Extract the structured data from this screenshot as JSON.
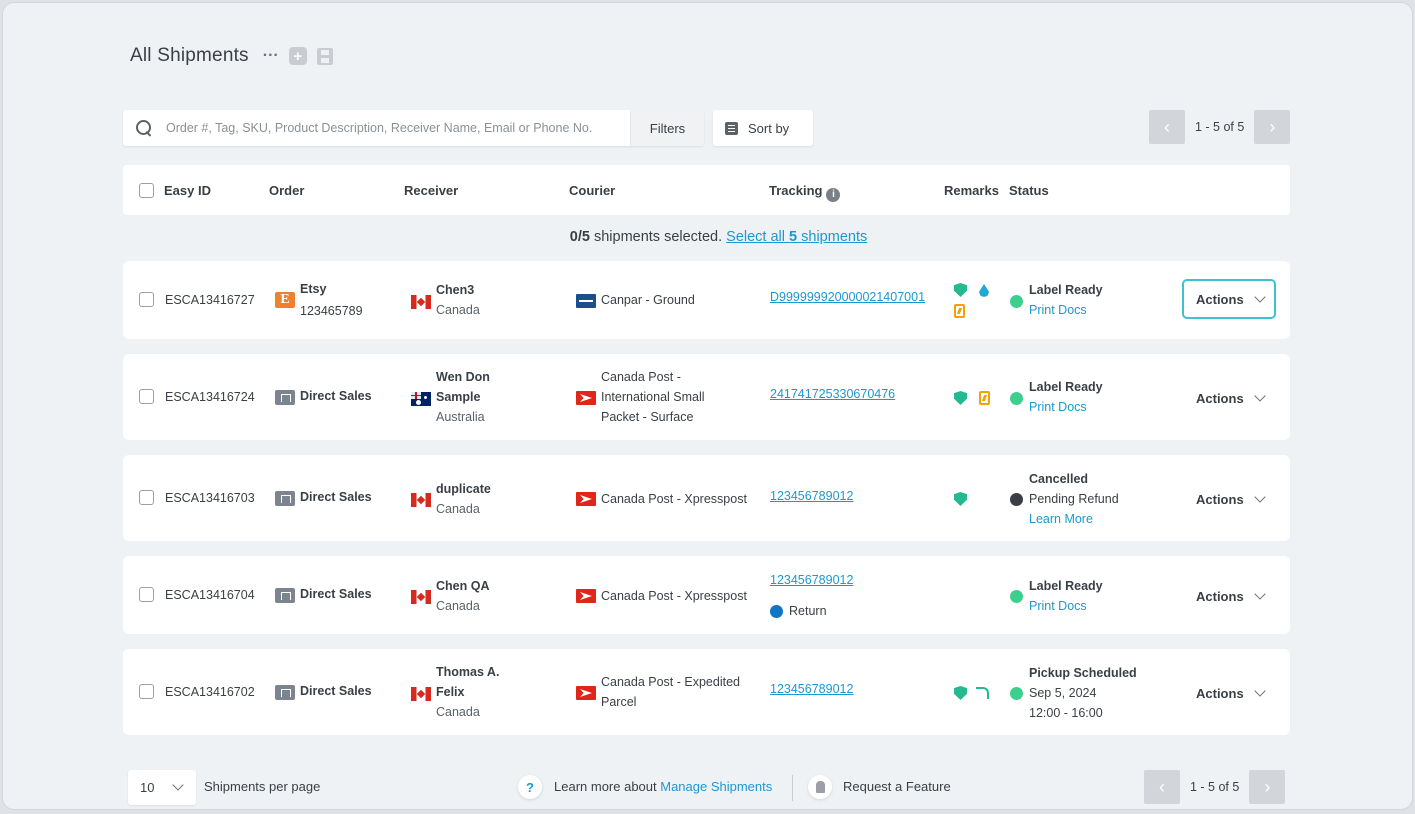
{
  "page": {
    "title": "All Shipments",
    "more_label": "···",
    "add_label": "+"
  },
  "search": {
    "placeholder": "Order #, Tag, SKU, Product Description, Receiver Name, Email or Phone No.",
    "filters_label": "Filters",
    "sort_label": "Sort by"
  },
  "pagination": {
    "range_text": "1 - 5 of 5",
    "prev": "‹",
    "next": "›"
  },
  "table": {
    "headers": {
      "easy_id": "Easy ID",
      "order": "Order",
      "receiver": "Receiver",
      "courier": "Courier",
      "tracking": "Tracking",
      "remarks": "Remarks",
      "status": "Status"
    },
    "selection": {
      "count": "0/5",
      "text": " shipments selected. ",
      "select_all_prefix": "Select all ",
      "select_all_count": "5",
      "select_all_suffix": " shipments"
    },
    "rows": [
      {
        "easy_id": "ESCA13416727",
        "order_source": "Etsy",
        "order_number": "123465789",
        "receiver_name_1": "Chen3",
        "receiver_name_2": "",
        "receiver_country": "Canada",
        "courier_1": "Canpar - Ground",
        "courier_2": "",
        "courier_3": "",
        "tracking": "D999999920000021407001",
        "tracking_extra": "",
        "status_1": "Label Ready",
        "status_2": "Print Docs",
        "status_3": "",
        "actions_label": "Actions"
      },
      {
        "easy_id": "ESCA13416724",
        "order_source": "Direct Sales",
        "order_number": "",
        "receiver_name_1": "Wen Don",
        "receiver_name_2": "Sample",
        "receiver_country": "Australia",
        "courier_1": "Canada Post -",
        "courier_2": "International Small",
        "courier_3": "Packet - Surface",
        "tracking": "241741725330670476",
        "tracking_extra": "",
        "status_1": "Label Ready",
        "status_2": "Print Docs",
        "status_3": "",
        "actions_label": "Actions"
      },
      {
        "easy_id": "ESCA13416703",
        "order_source": "Direct Sales",
        "order_number": "",
        "receiver_name_1": "duplicate",
        "receiver_name_2": "",
        "receiver_country": "Canada",
        "courier_1": "Canada Post - Xpresspost",
        "courier_2": "",
        "courier_3": "",
        "tracking": "123456789012",
        "tracking_extra": "",
        "status_1": "Cancelled",
        "status_2": "Pending Refund",
        "status_3": "Learn More",
        "actions_label": "Actions"
      },
      {
        "easy_id": "ESCA13416704",
        "order_source": "Direct Sales",
        "order_number": "",
        "receiver_name_1": "Chen QA",
        "receiver_name_2": "",
        "receiver_country": "Canada",
        "courier_1": "Canada Post - Xpresspost",
        "courier_2": "",
        "courier_3": "",
        "tracking": "123456789012",
        "tracking_extra": "Return",
        "status_1": "Label Ready",
        "status_2": "Print Docs",
        "status_3": "",
        "actions_label": "Actions"
      },
      {
        "easy_id": "ESCA13416702",
        "order_source": "Direct Sales",
        "order_number": "",
        "receiver_name_1": "Thomas A.",
        "receiver_name_2": "Felix",
        "receiver_country": "Canada",
        "courier_1": "Canada Post - Expedited",
        "courier_2": "Parcel",
        "courier_3": "",
        "tracking": "123456789012",
        "tracking_extra": "",
        "status_1": "Pickup Scheduled",
        "status_2": "Sep 5, 2024",
        "status_3": "12:00 - 16:00",
        "actions_label": "Actions"
      }
    ]
  },
  "footer": {
    "per_page_value": "10",
    "per_page_label": "Shipments per page",
    "help_icon_label": "?",
    "learn_prefix": "Learn more about ",
    "learn_link": "Manage Shipments",
    "feature_label": "Request a Feature"
  },
  "colors": {
    "accent": "#1c98d0",
    "status_green": "#3ccf8e",
    "focus_ring": "#3cc3cf"
  }
}
